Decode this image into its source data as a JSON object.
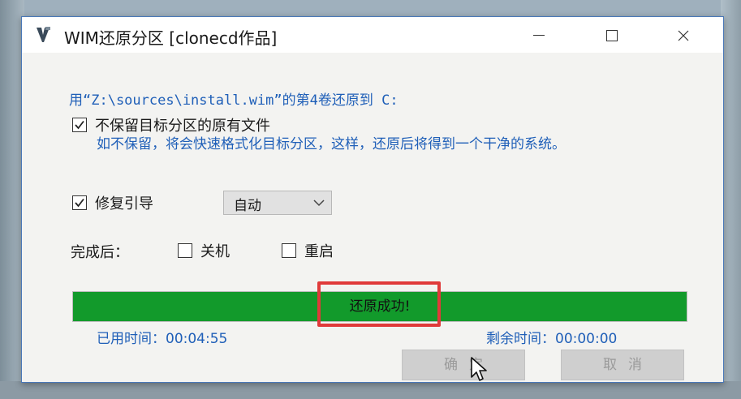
{
  "window": {
    "title": "WIM还原分区 [clonecd作品]",
    "description": "用“Z:\\sources\\install.wim”的第4卷还原到 C:"
  },
  "format_option": {
    "label": "不保留目标分区的原有文件",
    "checked": true,
    "hint": "如不保留，将会快速格式化目标分区，这样，还原后将得到一个干净的系统。"
  },
  "repair_boot": {
    "label": "修复引导",
    "checked": true,
    "mode_selected": "自动"
  },
  "after_complete": {
    "label": "完成后：",
    "shutdown_label": "关机",
    "shutdown_checked": false,
    "restart_label": "重启",
    "restart_checked": false
  },
  "progress": {
    "status": "还原成功!",
    "fraction": 1.0,
    "bar_color": "#129a2b"
  },
  "times": {
    "elapsed": "已用时间：00:04:55",
    "remaining": "剩余时间：00:00:00"
  },
  "buttons": {
    "ok_label": "确定",
    "cancel_label": "取消"
  },
  "colors": {
    "accent_text": "#1f5fb8",
    "highlight": "#e03a3a"
  },
  "icons": {
    "app": "app-icon",
    "minimize": "minimize-icon",
    "maximize": "maximize-icon",
    "close": "close-icon",
    "check": "checkmark-icon",
    "dropdown": "chevron-down-icon",
    "cursor": "mouse-cursor-icon"
  }
}
